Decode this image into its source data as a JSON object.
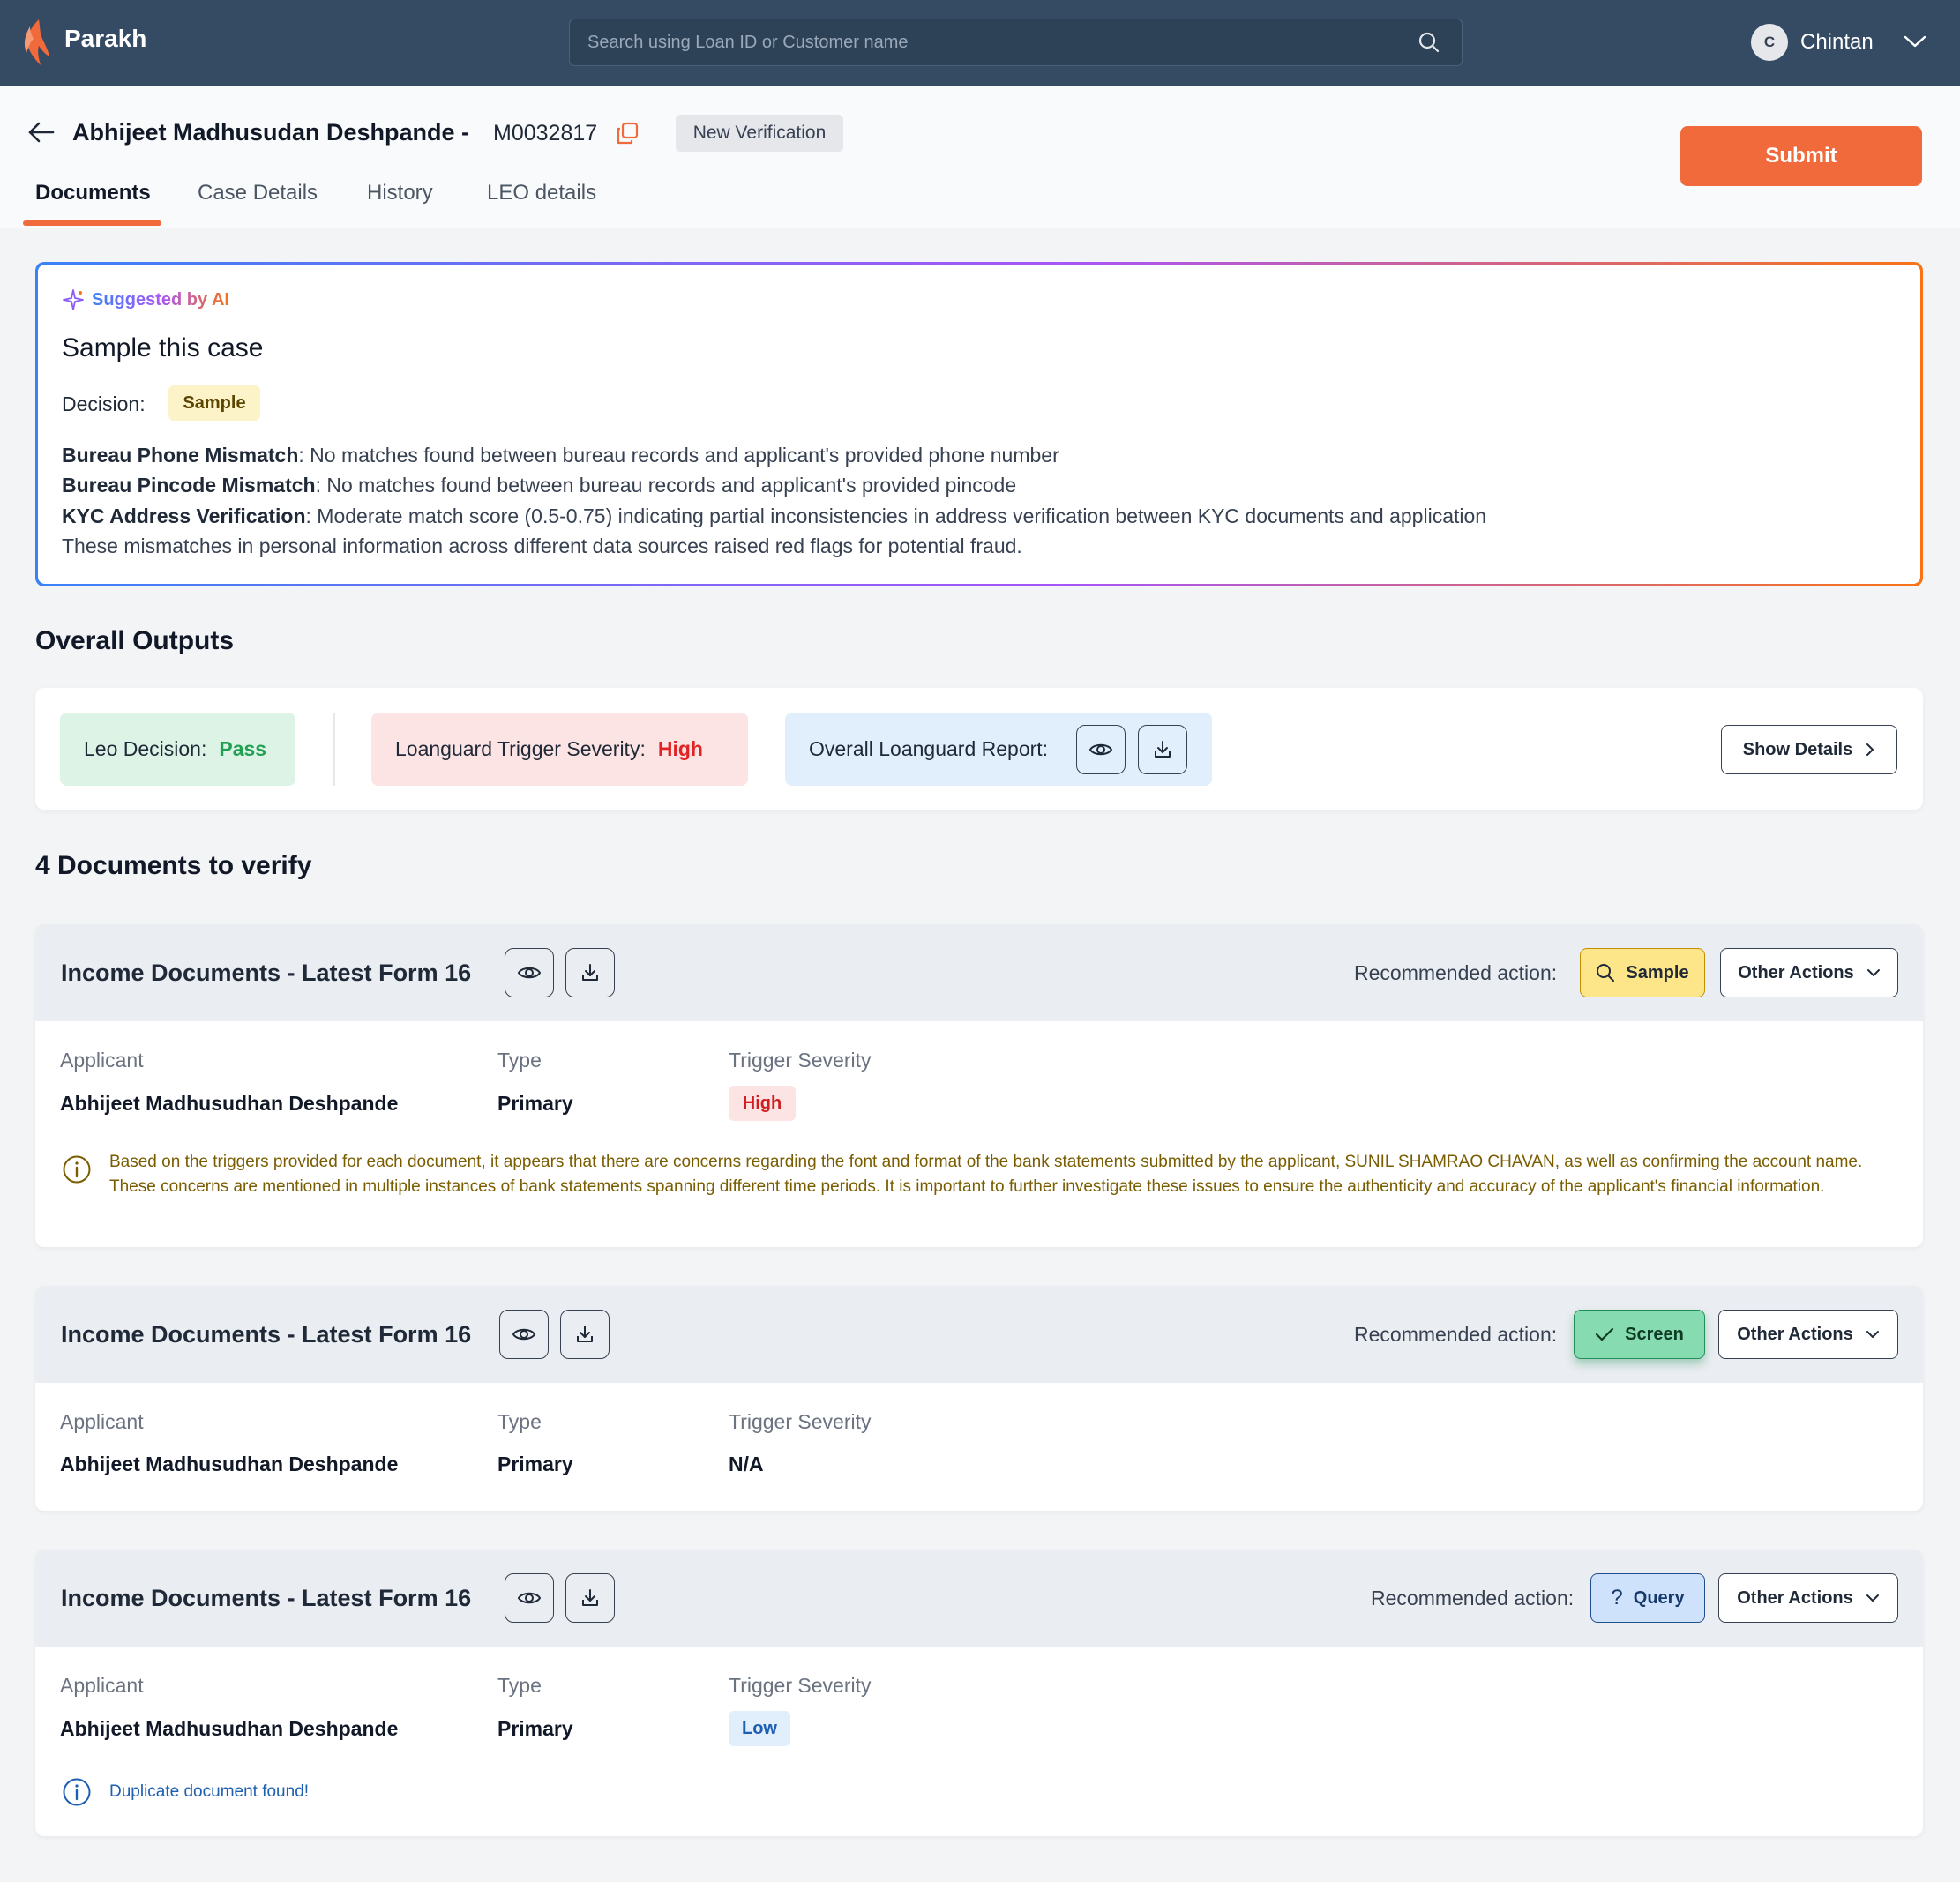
{
  "app": {
    "name": "Parakh"
  },
  "search": {
    "placeholder": "Search using Loan ID or Customer name"
  },
  "user": {
    "initial": "C",
    "name": "Chintan"
  },
  "case": {
    "customer_name": "Abhijeet Madhusudan Deshpande -",
    "loan_id": "M0032817",
    "status": "New Verification",
    "submit_label": "Submit"
  },
  "tabs": [
    "Documents",
    "Case Details",
    "History",
    "LEO details"
  ],
  "ai_suggestion": {
    "label": "Suggested by AI",
    "title": "Sample this case",
    "decision_label": "Decision:",
    "decision_value": "Sample",
    "reasons": [
      {
        "heading": "Bureau Phone Mismatch",
        "text": ": No matches found between bureau records and applicant's provided phone number"
      },
      {
        "heading": "Bureau Pincode Mismatch",
        "text": ": No matches found between bureau records and applicant's provided pincode"
      },
      {
        "heading": "KYC Address Verification",
        "text": ": Moderate match score (0.5-0.75) indicating partial inconsistencies in address verification between KYC documents and application"
      },
      {
        "heading": "",
        "text": "These mismatches in personal information across different data sources raised red flags for potential fraud."
      }
    ]
  },
  "overall": {
    "section_title": "Overall Outputs",
    "leo_label": "Leo Decision:",
    "leo_value": "Pass",
    "severity_label": "Loanguard Trigger Severity:",
    "severity_value": "High",
    "report_label": "Overall Loanguard Report:",
    "show_details_label": "Show Details"
  },
  "documents": {
    "section_title": "4 Documents to verify",
    "rec_label": "Recommended action:",
    "other_actions_label": "Other Actions",
    "field_labels": {
      "applicant": "Applicant",
      "type": "Type",
      "severity": "Trigger Severity"
    },
    "items": [
      {
        "title": "Income Documents - Latest Form 16",
        "action": "Sample",
        "applicant": "Abhijeet Madhusudhan Deshpande",
        "type": "Primary",
        "severity": "High",
        "note": "Based on the triggers provided for each document, it appears that there are concerns regarding the font and format of the bank statements submitted by the applicant, SUNIL SHAMRAO CHAVAN, as well as confirming the account name. These concerns are mentioned in multiple instances of bank statements spanning different time periods. It is important to further investigate these issues to ensure the authenticity and accuracy of the applicant's financial information."
      },
      {
        "title": "Income Documents - Latest Form 16",
        "action": "Screen",
        "applicant": "Abhijeet Madhusudhan Deshpande",
        "type": "Primary",
        "severity": "N/A"
      },
      {
        "title": "Income Documents - Latest Form 16",
        "action": "Query",
        "applicant": "Abhijeet Madhusudhan Deshpande",
        "type": "Primary",
        "severity": "Low",
        "note": "Duplicate document found!"
      }
    ]
  },
  "colors": {
    "accent": "#f06a3c",
    "topbar": "#344b63",
    "pass": "#22a052",
    "high": "#e02424"
  }
}
